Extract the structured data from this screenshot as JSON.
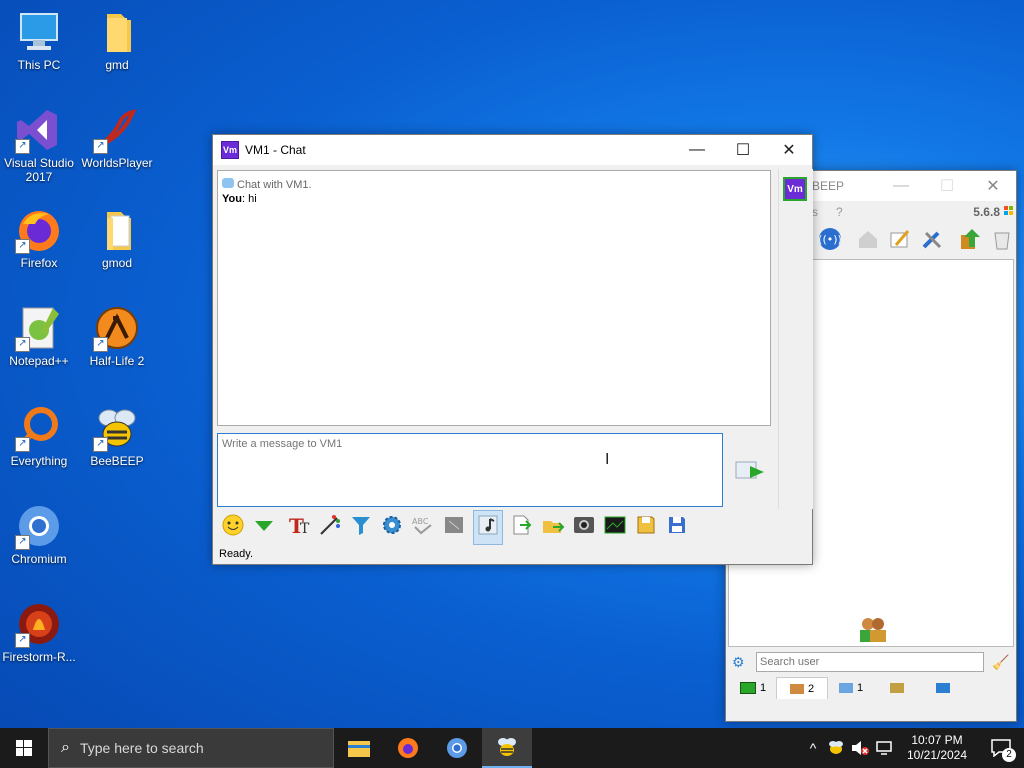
{
  "desktop": {
    "icons": [
      {
        "label": "This PC"
      },
      {
        "label": "gmd"
      },
      {
        "label": "Visual Studio\n2017"
      },
      {
        "label": "WorldsPlayer"
      },
      {
        "label": "Firefox"
      },
      {
        "label": "gmod"
      },
      {
        "label": "Notepad++"
      },
      {
        "label": "Half-Life 2"
      },
      {
        "label": "Everything"
      },
      {
        "label": "BeeBEEP"
      },
      {
        "label": "Chromium"
      },
      {
        "label": "Firestorm-R..."
      }
    ]
  },
  "chat_window": {
    "title": "VM1 - Chat",
    "badge": "Vm",
    "header_line": "Chat with VM1.",
    "message_sender": "You",
    "message_text": "hi",
    "input_placeholder": "Write a message to VM1",
    "status": "Ready."
  },
  "main_window": {
    "title_fragment": "BEEP",
    "menu_fragment": "s",
    "menu_help": "?",
    "version": "5.6.8",
    "search_placeholder": "Search user",
    "tabs": [
      {
        "count": "1"
      },
      {
        "count": "2"
      },
      {
        "count": "1"
      },
      {
        "count": ""
      },
      {
        "count": ""
      }
    ]
  },
  "taskbar": {
    "search_placeholder": "Type here to search",
    "time": "10:07 PM",
    "date": "10/21/2024",
    "notifications": "2"
  }
}
